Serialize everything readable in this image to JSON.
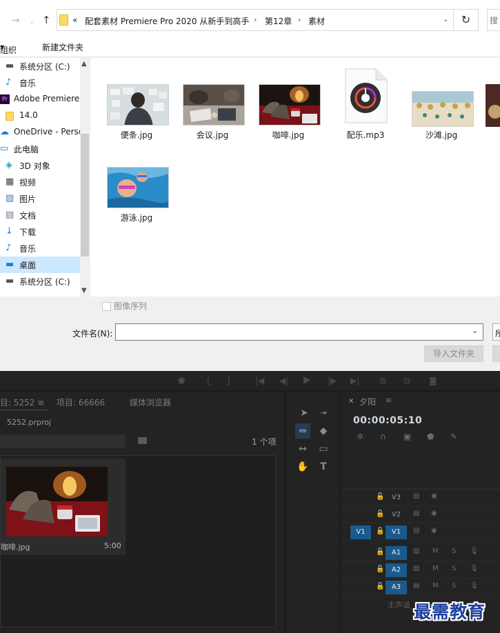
{
  "dialog": {
    "breadcrumbs": [
      "«",
      "配套素材 Premiere Pro 2020 从新手到高手",
      "第12章",
      "素材"
    ],
    "search_placeholder": "搜",
    "toolbar": {
      "organize": "组织",
      "new_folder": "新建文件夹"
    },
    "nav_items": [
      {
        "label": "系统分区 (C:)",
        "icon": "drive-icon"
      },
      {
        "label": "音乐",
        "icon": "music-icon"
      },
      {
        "label": "Adobe Premiere",
        "icon": "premiere-icon"
      },
      {
        "label": "14.0",
        "icon": "folder-icon"
      },
      {
        "label": "OneDrive - Perso",
        "icon": "cloud-icon"
      },
      {
        "label": "此电脑",
        "icon": "computer-icon"
      },
      {
        "label": "3D 对象",
        "icon": "cube-icon"
      },
      {
        "label": "视频",
        "icon": "video-icon"
      },
      {
        "label": "图片",
        "icon": "picture-icon"
      },
      {
        "label": "文档",
        "icon": "document-icon"
      },
      {
        "label": "下载",
        "icon": "download-icon"
      },
      {
        "label": "音乐",
        "icon": "music-icon"
      },
      {
        "label": "桌面",
        "icon": "desktop-icon"
      },
      {
        "label": "系统分区 (C:)",
        "icon": "drive-icon"
      }
    ],
    "files": [
      {
        "name": "便条.jpg",
        "kind": "image"
      },
      {
        "name": "会议.jpg",
        "kind": "image"
      },
      {
        "name": "咖啡.jpg",
        "kind": "image"
      },
      {
        "name": "配乐.mp3",
        "kind": "audio"
      },
      {
        "name": "沙滩.jpg",
        "kind": "image"
      },
      {
        "name": "游泳.jpg",
        "kind": "image"
      }
    ],
    "image_sequence_label": "图像序列",
    "filename_label": "文件名(N):",
    "filename_value": "",
    "open_button_partial": "所",
    "import_folder_button": "导入文件夹"
  },
  "premiere": {
    "project_tabs": [
      "目: 5252",
      "项目: 66666",
      "媒体浏览器"
    ],
    "project_file": "5252.prproj",
    "item_count": "1 个项",
    "clip": {
      "name": "咖啡.jpg",
      "duration": "5:00"
    },
    "timeline": {
      "close": "×",
      "title": "夕阳",
      "timecode": "00:00:05:10",
      "tracks": [
        {
          "name": "V3",
          "source": "",
          "on": false,
          "type": "video"
        },
        {
          "name": "V2",
          "source": "",
          "on": false,
          "type": "video"
        },
        {
          "name": "V1",
          "source": "V1",
          "on": true,
          "type": "video"
        },
        {
          "name": "A1",
          "source": "",
          "on": true,
          "type": "audio"
        },
        {
          "name": "A2",
          "source": "",
          "on": true,
          "type": "audio"
        },
        {
          "name": "A3",
          "source": "",
          "on": true,
          "type": "audio"
        }
      ],
      "mute_label": "M",
      "solo_label": "S",
      "master": "主声道"
    }
  },
  "watermark": "最需教育",
  "colors": {
    "accent": "#1a5a8c",
    "selection": "#cce8ff",
    "watermark": "#1f3f9c"
  }
}
